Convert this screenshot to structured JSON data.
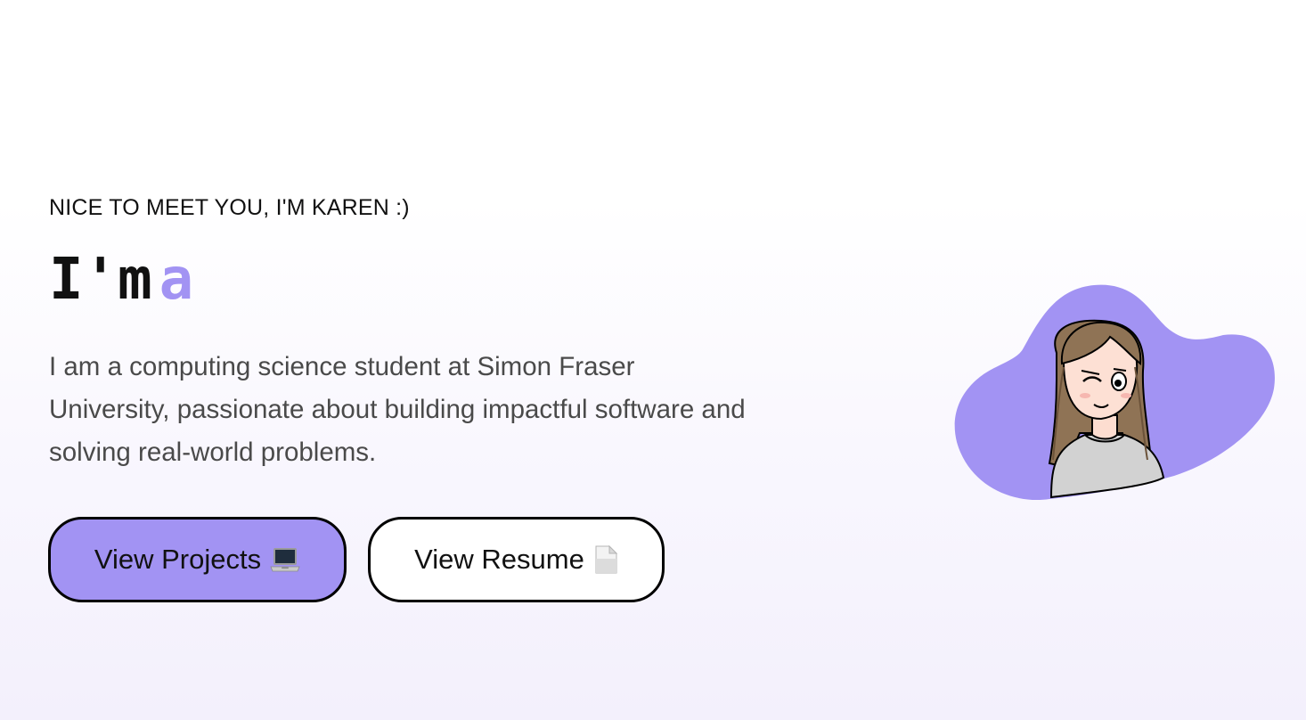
{
  "hero": {
    "greeting": "NICE TO MEET YOU, I'M KAREN :)",
    "headline_prefix": "I'm",
    "headline_typed": "a",
    "bio": "I am a computing science student at Simon Fraser University, passionate about building impactful software and solving real-world problems."
  },
  "buttons": {
    "projects_label": "View Projects",
    "projects_icon": "laptop-icon",
    "resume_label": "View Resume",
    "resume_icon": "document-icon"
  },
  "avatar": {
    "icon": "girl-avatar-illustration",
    "blob_color": "#a293f3"
  },
  "colors": {
    "accent": "#a293f3",
    "text": "#111111",
    "body_text": "#4a4a4a"
  }
}
